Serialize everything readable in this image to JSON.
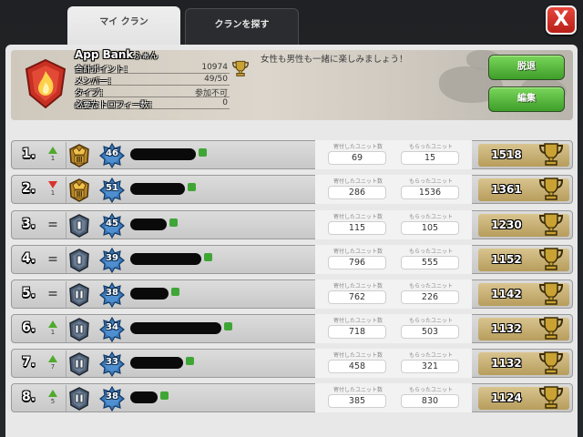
{
  "tabs": {
    "my_clan": "マイ クラン",
    "find_clan": "クランを探す"
  },
  "close_label": "X",
  "clan": {
    "name": "App Bank",
    "name_suffix": "ふぁん",
    "description": "女性も男性も一緒に楽しみましょう！",
    "stats": [
      {
        "label": "合計ポイント：",
        "value": "10974"
      },
      {
        "label": "メンバー：",
        "value": "49/50"
      },
      {
        "label": "タイプ：",
        "value": "参加不可"
      },
      {
        "label": "必要なトロフィー数：",
        "value": "0"
      }
    ],
    "leave_button": "脱退",
    "edit_button": "編集"
  },
  "columns": {
    "donated": "寄付したユニット数",
    "received": "もらったユニット"
  },
  "members": [
    {
      "rank": "1.",
      "change": "up",
      "change_num": "1",
      "role": "leader",
      "level": "46",
      "donated": "69",
      "received": "15",
      "trophies": "1518"
    },
    {
      "rank": "2.",
      "change": "down",
      "change_num": "1",
      "role": "leader",
      "level": "51",
      "donated": "286",
      "received": "1536",
      "trophies": "1361"
    },
    {
      "rank": "3.",
      "change": "same",
      "change_num": "=",
      "role": "elder",
      "level": "45",
      "donated": "115",
      "received": "105",
      "trophies": "1230"
    },
    {
      "rank": "4.",
      "change": "same",
      "change_num": "=",
      "role": "elder",
      "level": "39",
      "donated": "796",
      "received": "555",
      "trophies": "1152"
    },
    {
      "rank": "5.",
      "change": "same",
      "change_num": "=",
      "role": "member",
      "level": "38",
      "donated": "762",
      "received": "226",
      "trophies": "1142"
    },
    {
      "rank": "6.",
      "change": "up",
      "change_num": "1",
      "role": "member",
      "level": "34",
      "donated": "718",
      "received": "503",
      "trophies": "1132"
    },
    {
      "rank": "7.",
      "change": "up",
      "change_num": "7",
      "role": "member",
      "level": "33",
      "donated": "458",
      "received": "321",
      "trophies": "1132"
    },
    {
      "rank": "8.",
      "change": "up",
      "change_num": "5",
      "role": "member",
      "level": "38",
      "donated": "385",
      "received": "830",
      "trophies": "1124"
    }
  ],
  "colors": {
    "accent_green": "#4faa2c",
    "down_red": "#d9342a",
    "trophy_gold": "#c9a233",
    "level_blue": "#3b78b8"
  }
}
